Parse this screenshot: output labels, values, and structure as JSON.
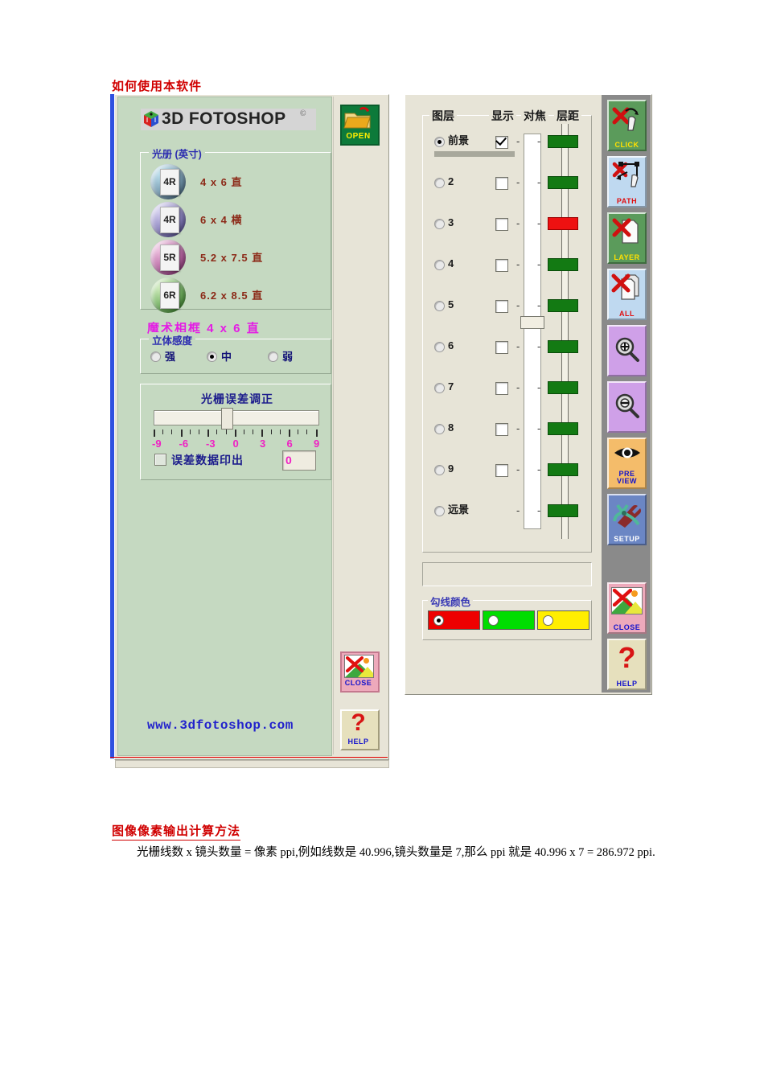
{
  "document": {
    "heading1": "如何使用本软件",
    "heading2": "图像像素输出计算方法",
    "paragraph": "光栅线数 x 镜头数量 = 像素 ppi,例如线数是 40.996,镜头数量是 7,那么 ppi 就是 40.996 x 7 = 286.972 ppi."
  },
  "app": {
    "logo_text": "3D FOTOSHOP",
    "logo_copyright": "©",
    "website": "www.3dfotoshop.com"
  },
  "left_panel": {
    "size_group_title": "光册 (英寸)",
    "sizes": [
      {
        "badge": "4R",
        "label": "4 x 6 直",
        "ball_from": "#bfe4f2",
        "ball_to": "#5b7e96"
      },
      {
        "badge": "4R",
        "label": "6 x 4 横",
        "ball_from": "#d8d3f3",
        "ball_to": "#6b63a8"
      },
      {
        "badge": "5R",
        "label": "5.2 x 7.5 直",
        "ball_from": "#f3c6e4",
        "ball_to": "#a2468b"
      },
      {
        "badge": "6R",
        "label": "6.2 x 8.5 直",
        "ball_from": "#d6f0c2",
        "ball_to": "#4f9a3e"
      }
    ],
    "magic_frame_label": "魔术相框 4 x 6 直",
    "depth_group_title": "立体感度",
    "depth_options": [
      {
        "label": "强",
        "selected": false
      },
      {
        "label": "中",
        "selected": true
      },
      {
        "label": "弱",
        "selected": false
      }
    ],
    "calibration": {
      "title": "光栅误差调正",
      "scale_labels": [
        "-9",
        "-6",
        "-3",
        "0",
        "3",
        "6",
        "9"
      ],
      "slider_value": "0",
      "print_error_label": "误差数据印出",
      "print_error_checked": false,
      "value_box": "0"
    }
  },
  "right_panel": {
    "columns": [
      "图层",
      "显示",
      "对焦",
      "层距"
    ],
    "layers": [
      {
        "name": "前景",
        "selected": true,
        "visible": true,
        "has_checkbox": true,
        "pip_color": "green"
      },
      {
        "name": "2",
        "selected": false,
        "visible": false,
        "has_checkbox": true,
        "pip_color": "green"
      },
      {
        "name": "3",
        "selected": false,
        "visible": false,
        "has_checkbox": true,
        "pip_color": "red"
      },
      {
        "name": "4",
        "selected": false,
        "visible": false,
        "has_checkbox": true,
        "pip_color": "green"
      },
      {
        "name": "5",
        "selected": false,
        "visible": false,
        "has_checkbox": true,
        "pip_color": "green"
      },
      {
        "name": "6",
        "selected": false,
        "visible": false,
        "has_checkbox": true,
        "pip_color": "green"
      },
      {
        "name": "7",
        "selected": false,
        "visible": false,
        "has_checkbox": true,
        "pip_color": "green"
      },
      {
        "name": "8",
        "selected": false,
        "visible": false,
        "has_checkbox": true,
        "pip_color": "green"
      },
      {
        "name": "9",
        "selected": false,
        "visible": false,
        "has_checkbox": true,
        "pip_color": "green"
      },
      {
        "name": "远景",
        "selected": false,
        "visible": false,
        "has_checkbox": false,
        "pip_color": "green"
      }
    ],
    "dash_marker": "-",
    "focus_slider_position_layer": "5",
    "line_color_group_title": "勾线颜色",
    "line_colors": [
      {
        "hex": "#ee0000",
        "selected": true
      },
      {
        "hex": "#00dd00",
        "selected": false
      },
      {
        "hex": "#ffee00",
        "selected": false
      }
    ]
  },
  "toolbar": {
    "buttons": [
      {
        "id": "click",
        "caption": "CLICK",
        "bg": "#5b9b5b",
        "caption_color": "#ffe000"
      },
      {
        "id": "path",
        "caption": "PATH",
        "bg": "#bfd9f0",
        "caption_color": "#e01010"
      },
      {
        "id": "layer",
        "caption": "LAYER",
        "bg": "#5b9b5b",
        "caption_color": "#ffe000"
      },
      {
        "id": "all",
        "caption": "ALL",
        "bg": "#bfd9f0",
        "caption_color": "#e01010"
      },
      {
        "id": "zoomin",
        "caption": "",
        "bg": "#cfa0e8",
        "caption_color": "#000000"
      },
      {
        "id": "zoomout",
        "caption": "",
        "bg": "#cfa0e8",
        "caption_color": "#000000"
      },
      {
        "id": "preview",
        "caption": "PRE\nVIEW",
        "bg": "#f4bc6a",
        "caption_color": "#1414cc"
      },
      {
        "id": "setup",
        "caption": "SETUP",
        "bg": "#6b86c4",
        "caption_color": "#ffffff"
      },
      {
        "id": "close",
        "caption": "CLOSE",
        "bg": "#eda9bb",
        "caption_color": "#1414cc"
      },
      {
        "id": "help",
        "caption": "HELP",
        "bg": "#e6e0bd",
        "caption_color": "#1414cc"
      }
    ],
    "open_caption": "OPEN",
    "close_caption": "CLOSE",
    "help_caption": "HELP"
  }
}
